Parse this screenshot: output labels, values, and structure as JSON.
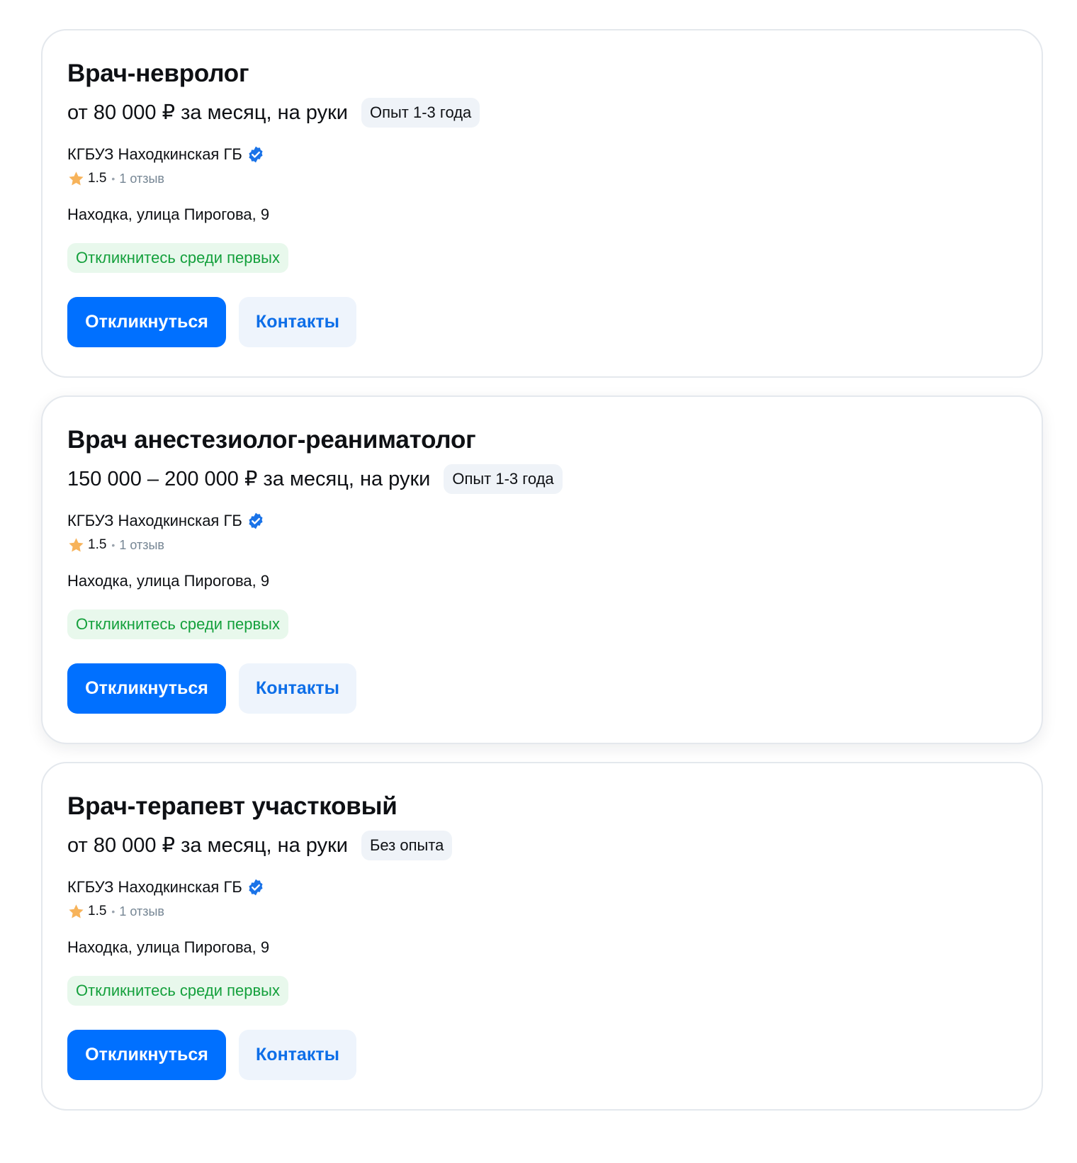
{
  "vacancies": [
    {
      "title": "Врач-невролог",
      "salary": "от 80 000 ₽ за месяц, на руки",
      "experience": "Опыт 1-3 года",
      "company": "КГБУЗ Находкинская ГБ",
      "rating": "1.5",
      "reviews": "1 отзыв",
      "address": "Находка, улица Пирогова, 9",
      "badge": "Откликнитесь среди первых",
      "respond_label": "Откликнуться",
      "contacts_label": "Контакты"
    },
    {
      "title": "Врач анестезиолог-реаниматолог",
      "salary": "150 000 – 200 000 ₽ за месяц, на руки",
      "experience": "Опыт 1-3 года",
      "company": "КГБУЗ Находкинская ГБ",
      "rating": "1.5",
      "reviews": "1 отзыв",
      "address": "Находка, улица Пирогова, 9",
      "badge": "Откликнитесь среди первых",
      "respond_label": "Откликнуться",
      "contacts_label": "Контакты"
    },
    {
      "title": "Врач-терапевт участковый",
      "salary": "от 80 000 ₽ за месяц, на руки",
      "experience": "Без опыта",
      "company": "КГБУЗ Находкинская ГБ",
      "rating": "1.5",
      "reviews": "1 отзыв",
      "address": "Находка, улица Пирогова, 9",
      "badge": "Откликнитесь среди первых",
      "respond_label": "Откликнуться",
      "contacts_label": "Контакты"
    }
  ],
  "colors": {
    "primary": "#0070ff",
    "verified": "#1a73e8",
    "star": "#f7b35a",
    "badge_green_text": "#14a03c",
    "badge_green_bg": "#e8f8ec"
  },
  "icons": {
    "verified": "verified-check-icon",
    "rating": "star-icon"
  }
}
